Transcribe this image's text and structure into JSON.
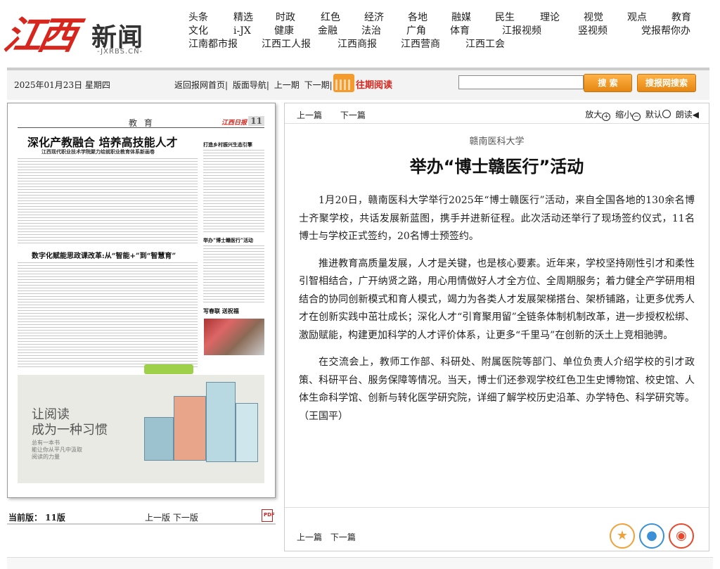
{
  "header": {
    "logo_text": "江西新闻",
    "logo_domain": "-JXRBS.CN-",
    "nav_rows": [
      [
        "头条",
        "精选",
        "时政",
        "红色",
        "经济",
        "各地",
        "融媒",
        "民生",
        "理论",
        "视觉",
        "观点",
        "教育"
      ],
      [
        "文化",
        "i-JX",
        "健康",
        "金融",
        "法治",
        "广角",
        "体育",
        "江报视频",
        "竖视频",
        "党报帮你办"
      ],
      [
        "江南都市报",
        "江西工人报",
        "江西商报",
        "江西营商",
        "江西工会"
      ]
    ]
  },
  "toolbar": {
    "date": "2025年01月23日 星期四",
    "links": [
      "返回报网首页|",
      "版面导航|",
      "上一期",
      "下一期|"
    ],
    "past_label": "往期阅读",
    "search_placeholder": "",
    "search_button": "搜 索",
    "site_search_button": "搜报网搜索"
  },
  "thumbnail": {
    "section": "教 育",
    "page_no": "11",
    "brand": "江西日报",
    "headline": "深化产教融合 培养高技能人才",
    "subhead": "江西现代职业技术学院聚力绘就职业教育体系新画卷",
    "headline2": "数字化赋能思政课改革:从“智能+”到“智慧育”",
    "side1": "打造乡村振兴生态引擎",
    "side2": "举办“博士赣医行”活动",
    "side3": "写春联 送祝福",
    "ad_line1": "让阅读",
    "ad_line2": "成为一种习惯",
    "ad_small": "总有一本书\n能让你从平凡中汲取\n阅读的力量"
  },
  "page_footer": {
    "current": "当前版： 11版",
    "prev": "上一版",
    "next": "下一版"
  },
  "article": {
    "prev": "上一篇",
    "next": "下一篇",
    "zoom_in": "放大",
    "zoom_out": "缩小",
    "default": "默认",
    "read": "朗读",
    "kicker": "赣南医科大学",
    "title": "举办“博士赣医行”活动",
    "paragraphs": [
      "1月20日，赣南医科大学举行2025年“博士赣医行”活动，来自全国各地的130余名博士齐聚学校，共话发展新蓝图，携手并进新征程。此次活动还举行了现场签约仪式，11名博士与学校正式签约，20名博士预签约。",
      "推进教育高质量发展，人才是关键，也是核心要素。近年来，学校坚持刚性引才和柔性引智相结合，广开纳贤之路，用心用情做好人才全方位、全周期服务；着力健全产学研用相结合的协同创新模式和育人模式，竭力为各类人才发展架梯搭台、架桥铺路，让更多优秀人才在创新实践中茁壮成长；深化人才“引育聚用留”全链条体制机制改革，进一步授权松绑、激励赋能，构建更加科学的人才评价体系，让更多“千里马”在创新的沃土上竞相驰骋。",
      "在交流会上，教师工作部、科研处、附属医院等部门、单位负责人介绍学校的引才政策、科研平台、服务保障等情况。当天，博士们还参观学校红色卫生史博物馆、校史馆、人体生命科学馆、创新与转化医学研究院，详细了解学校历史沿革、办学特色、科学研究等。（王国平）"
    ],
    "bottom_prev": "上一篇",
    "bottom_next": "下一篇"
  },
  "colors": {
    "brand_red": "#d7261e",
    "orange": "#f0a23a"
  }
}
